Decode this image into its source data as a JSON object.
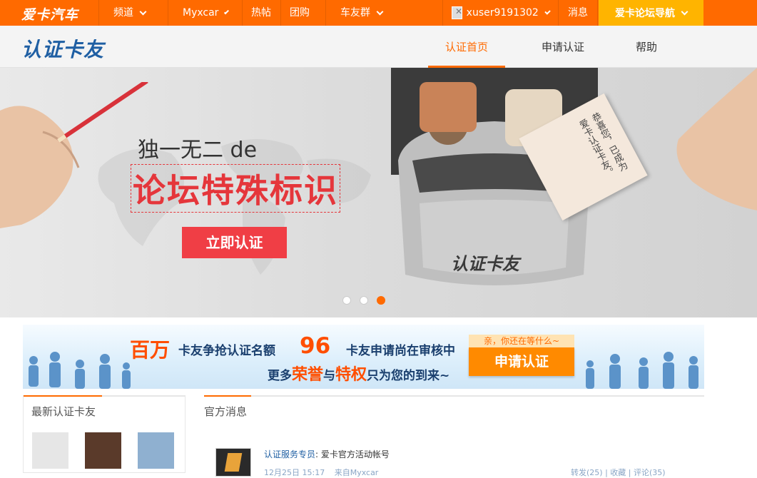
{
  "topbar": {
    "logo": "爱卡汽车",
    "nav": [
      {
        "label": "频道",
        "dropdown": true
      },
      {
        "label": "Myxcar",
        "dropdown": true
      },
      {
        "label": "热帖",
        "dropdown": false
      },
      {
        "label": "团购",
        "dropdown": false
      },
      {
        "label": "车友群",
        "dropdown": true
      }
    ],
    "username": "xuser9191302",
    "messages": "消息",
    "guide": "爱卡论坛导航"
  },
  "subnav": {
    "brand": "认证卡友",
    "tabs": [
      {
        "label": "认证首页",
        "active": true
      },
      {
        "label": "申请认证",
        "active": false
      },
      {
        "label": "帮助",
        "active": false
      }
    ]
  },
  "hero": {
    "line1": "独一无二 de",
    "line2": "论坛特殊标识",
    "cta": "立即认证",
    "car_text": "认证卡友",
    "card_text": "恭喜您，已成为爱卡认证卡友。",
    "slides": 3,
    "active_slide": 3
  },
  "banner": {
    "big": "百万",
    "text1": "卡友争抢认证名额",
    "count": "96",
    "text2": "卡友申请尚在审核中",
    "line2_prefix": "更多",
    "honor": "荣誉",
    "and": "与",
    "privilege": "特权",
    "line2_suffix": "只为您的到来~",
    "tip": "亲，你还在等什么~",
    "button": "申请认证"
  },
  "latest": {
    "title": "最新认证卡友"
  },
  "official": {
    "title": "官方消息",
    "post": {
      "author": "认证服务专员",
      "sep": ":",
      "text": "爱卡官方活动帐号",
      "date": "12月25日 15:17",
      "from": "来自Myxcar",
      "ops": "转发(25) | 收藏 | 评论(35)"
    }
  },
  "colors": {
    "brand_orange": "#ff6a00",
    "guide_yellow": "#ffb400",
    "cta_red": "#f03e45",
    "brand_blue": "#1f5fa3"
  }
}
